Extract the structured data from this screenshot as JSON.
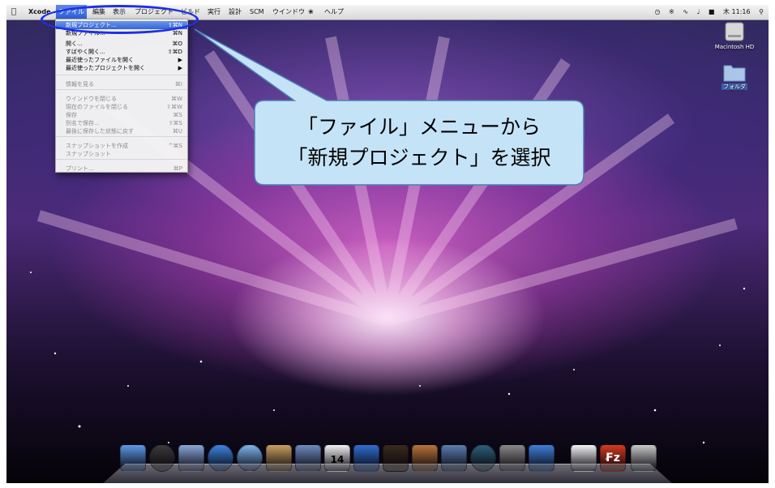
{
  "menubar": {
    "app_name": "Xcode",
    "items": [
      "ファイル",
      "編集",
      "表示",
      "プロジェクト",
      "ビルド",
      "実行",
      "設計",
      "SCM",
      "ウインドウ",
      "ヘルプ"
    ],
    "clock": "木 11:16"
  },
  "file_menu": {
    "items": [
      {
        "label": "新規プロジェクト...",
        "shortcut": "⇧⌘N",
        "state": "highlighted"
      },
      {
        "label": "新規ファイル...",
        "shortcut": "⌘N",
        "state": "enabled"
      },
      {
        "label": "開く...",
        "shortcut": "⌘O",
        "state": "enabled"
      },
      {
        "label": "すばやく開く...",
        "shortcut": "⇧⌘D",
        "state": "enabled"
      },
      {
        "label": "最近使ったファイルを開く",
        "shortcut": "▶",
        "state": "enabled"
      },
      {
        "label": "最近使ったプロジェクトを開く",
        "shortcut": "▶",
        "state": "enabled"
      },
      {
        "label": "情報を見る",
        "shortcut": "⌘I",
        "state": "disabled"
      },
      {
        "label": "ウインドウを閉じる",
        "shortcut": "⌘W",
        "state": "disabled"
      },
      {
        "label": "現在のファイルを閉じる",
        "shortcut": "⇧⌘W",
        "state": "disabled"
      },
      {
        "label": "保存",
        "shortcut": "⌘S",
        "state": "disabled"
      },
      {
        "label": "別名で保存...",
        "shortcut": "⇧⌘S",
        "state": "disabled"
      },
      {
        "label": "最後に保存した状態に戻す",
        "shortcut": "⌘U",
        "state": "disabled"
      },
      {
        "label": "スナップショットを作成",
        "shortcut": "^⌘S",
        "state": "disabled"
      },
      {
        "label": "スナップショット",
        "shortcut": "",
        "state": "disabled"
      },
      {
        "label": "プリント...",
        "shortcut": "⌘P",
        "state": "disabled"
      }
    ]
  },
  "callout": {
    "line1": "「ファイル」メニューから",
    "line2": "「新規プロジェクト」を選択"
  },
  "desktop": {
    "hd_label": "Macintosh HD",
    "folder_label": "フォルダ"
  },
  "dock": {
    "items": [
      "finder-icon",
      "dashboard-icon",
      "mail-icon",
      "safari-icon",
      "ichat-icon",
      "address-book-icon",
      "iphoto-icon",
      "ical-icon",
      "itunes-icon",
      "imovie-icon",
      "garageband-icon",
      "spaces-icon",
      "time-machine-icon",
      "system-preferences-icon",
      "xcode-icon",
      "document-icon",
      "filezilla-icon",
      "trash-icon"
    ],
    "ical_day": "14",
    "filezilla_letter": "Fz"
  },
  "colors": {
    "highlight": "#3566d6",
    "circle": "#1f2ee8",
    "callout_fill": "#c5e3f7"
  }
}
